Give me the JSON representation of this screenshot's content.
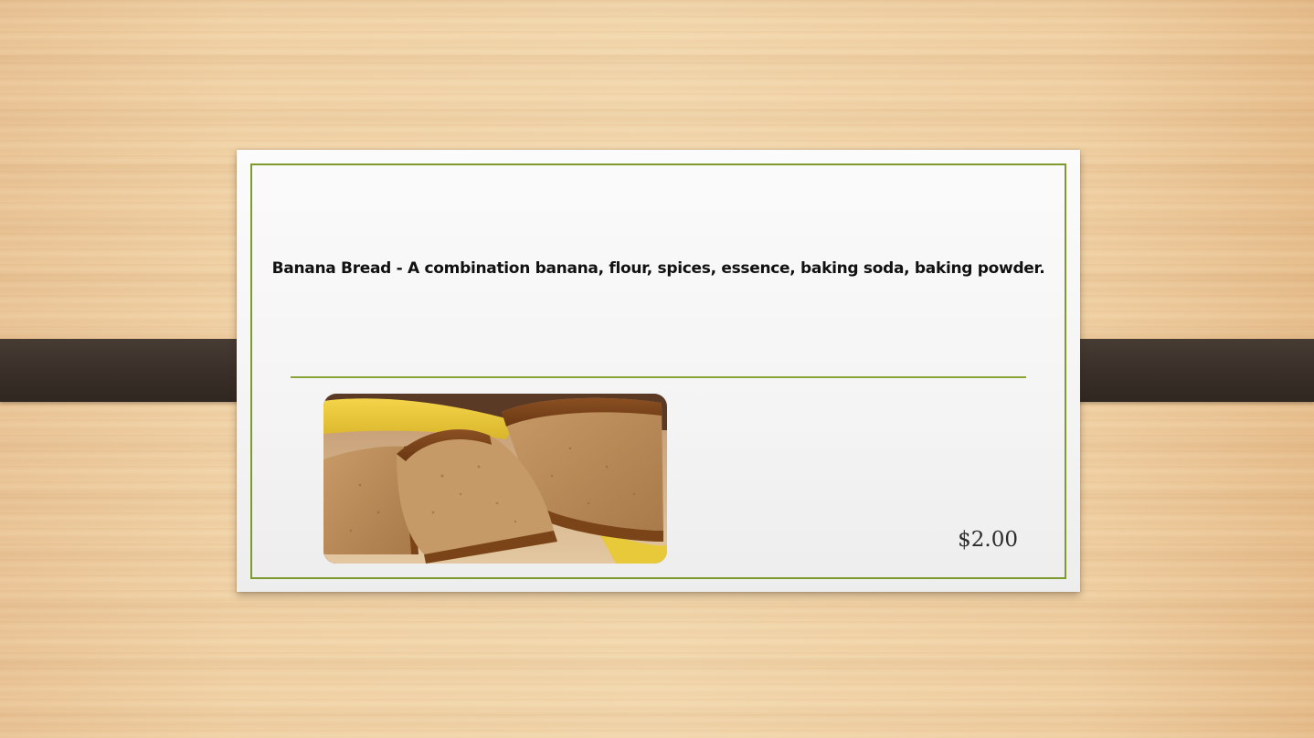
{
  "menu_card": {
    "title": "Banana Bread - A combination banana, flour, spices, essence, baking soda, baking powder.",
    "price": "$2.00",
    "image": "banana-bread-photo"
  },
  "colors": {
    "frame_accent": "#7f9a2c",
    "band": "#3a3029",
    "wood_background": "#f0d2a6"
  }
}
